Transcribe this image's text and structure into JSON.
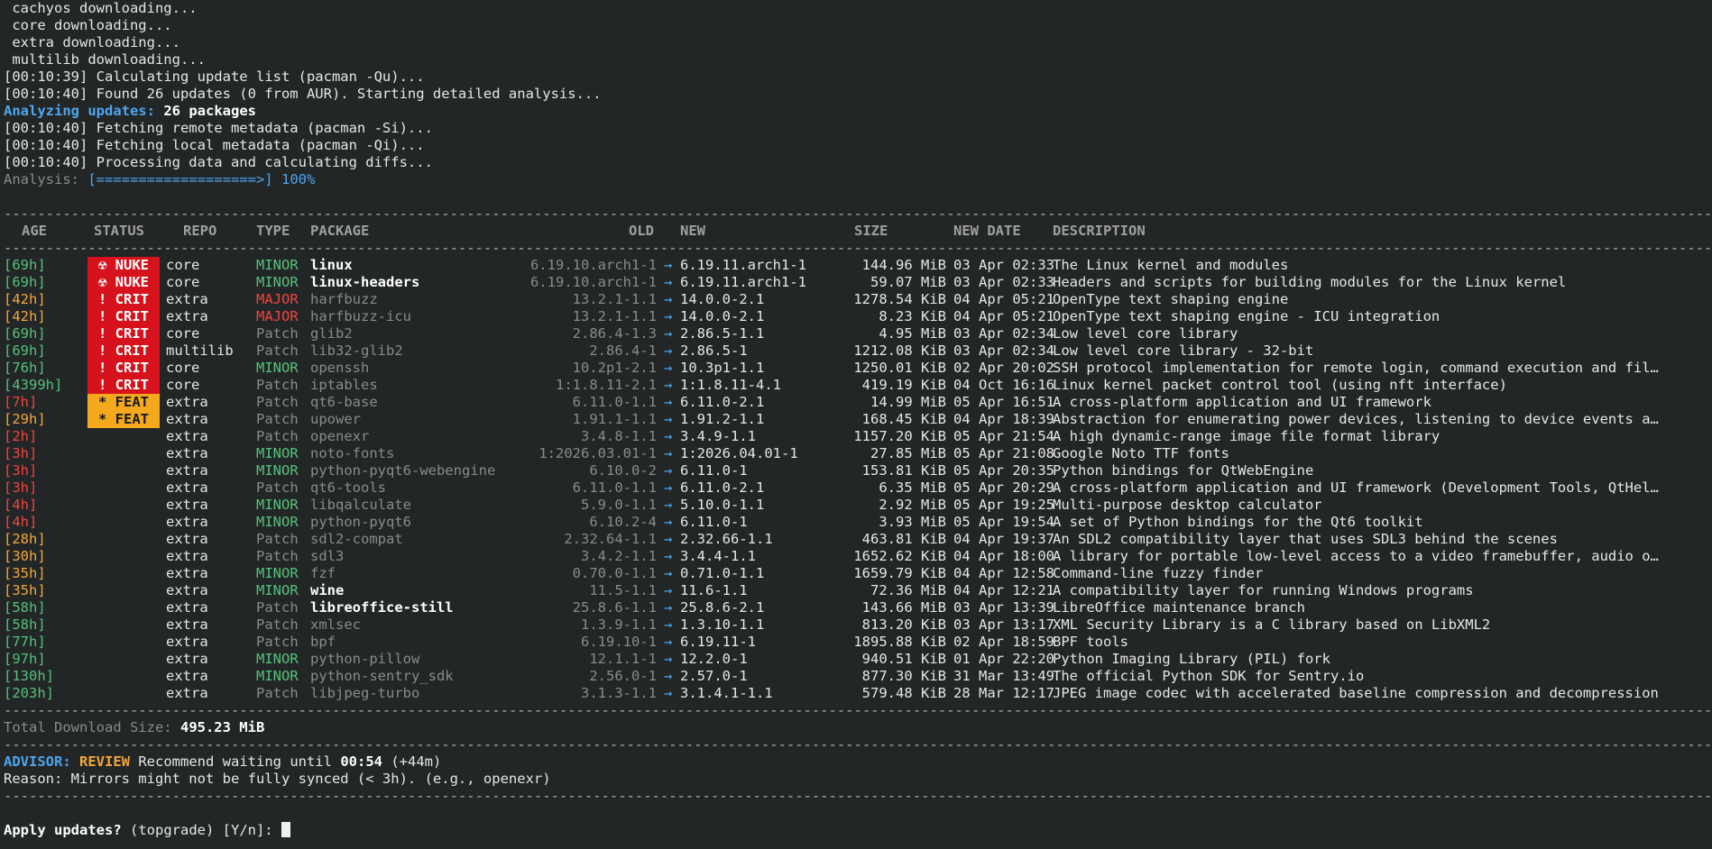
{
  "log": [
    " cachyos downloading...",
    " core downloading...",
    " extra downloading...",
    " multilib downloading...",
    "[00:10:39] Calculating update list (pacman -Qu)...",
    "[00:10:40] Found 26 updates (0 from AUR). Starting detailed analysis..."
  ],
  "analyzing": {
    "label": "Analyzing updates:",
    "count": "26 packages"
  },
  "log2": [
    "[00:10:40] Fetching remote metadata (pacman -Si)...",
    "[00:10:40] Fetching local metadata (pacman -Qi)...",
    "[00:10:40] Processing data and calculating diffs..."
  ],
  "progress": {
    "label": "Analysis:",
    "bar": "[===================>]",
    "percent": "100%"
  },
  "divider": "-----------------------------------------------------------------------------------------------------------------------------------------------------------------------------------------------------------------------------------------------",
  "headers": {
    "age": "AGE",
    "status": "STATUS",
    "repo": "REPO",
    "type": "TYPE",
    "package": "PACKAGE",
    "old": "OLD",
    "new": "NEW",
    "size": "SIZE",
    "date": "NEW DATE",
    "desc": "DESCRIPTION"
  },
  "arrow": "→",
  "colors": {
    "background": "#232627",
    "nuke": "#d6131c",
    "feat": "#f3a81e",
    "accent": "#4ea6ee",
    "minor": "#55c27a",
    "major": "#f0443e"
  },
  "rows": [
    {
      "age": "[69h]",
      "age_color": "grn",
      "status": "☢ NUKE",
      "status_kind": "nuke",
      "repo": "core",
      "type": "MINOR",
      "package": "linux",
      "pkg_bold": true,
      "old": "6.19.10.arch1-1",
      "new": "6.19.11.arch1-1",
      "size": "144.96 MiB",
      "date": "03 Apr 02:33",
      "desc": "The Linux kernel and modules"
    },
    {
      "age": "[69h]",
      "age_color": "grn",
      "status": "☢ NUKE",
      "status_kind": "nuke",
      "repo": "core",
      "type": "MINOR",
      "package": "linux-headers",
      "pkg_bold": true,
      "old": "6.19.10.arch1-1",
      "new": "6.19.11.arch1-1",
      "size": "59.07 MiB",
      "date": "03 Apr 02:33",
      "desc": "Headers and scripts for building modules for the Linux kernel"
    },
    {
      "age": "[42h]",
      "age_color": "yel",
      "status": "! CRIT",
      "status_kind": "crit",
      "repo": "extra",
      "type": "MAJOR",
      "package": "harfbuzz",
      "pkg_bold": false,
      "old": "13.2.1-1.1",
      "new": "14.0.0-2.1",
      "size": "1278.54 KiB",
      "date": "04 Apr 05:21",
      "desc": "OpenType text shaping engine"
    },
    {
      "age": "[42h]",
      "age_color": "yel",
      "status": "! CRIT",
      "status_kind": "crit",
      "repo": "extra",
      "type": "MAJOR",
      "package": "harfbuzz-icu",
      "pkg_bold": false,
      "old": "13.2.1-1.1",
      "new": "14.0.0-2.1",
      "size": "8.23 KiB",
      "date": "04 Apr 05:21",
      "desc": "OpenType text shaping engine - ICU integration"
    },
    {
      "age": "[69h]",
      "age_color": "grn",
      "status": "! CRIT",
      "status_kind": "crit",
      "repo": "core",
      "type": "Patch",
      "package": "glib2",
      "pkg_bold": false,
      "old": "2.86.4-1.3",
      "new": "2.86.5-1.1",
      "size": "4.95 MiB",
      "date": "03 Apr 02:34",
      "desc": "Low level core library"
    },
    {
      "age": "[69h]",
      "age_color": "grn",
      "status": "! CRIT",
      "status_kind": "crit",
      "repo": "multilib",
      "type": "Patch",
      "package": "lib32-glib2",
      "pkg_bold": false,
      "old": "2.86.4-1",
      "new": "2.86.5-1",
      "size": "1212.08 KiB",
      "date": "03 Apr 02:34",
      "desc": "Low level core library - 32-bit"
    },
    {
      "age": "[76h]",
      "age_color": "grn",
      "status": "! CRIT",
      "status_kind": "crit",
      "repo": "core",
      "type": "MINOR",
      "package": "openssh",
      "pkg_bold": false,
      "old": "10.2p1-2.1",
      "new": "10.3p1-1.1",
      "size": "1250.01 KiB",
      "date": "02 Apr 20:02",
      "desc": "SSH protocol implementation for remote login, command execution and fil…"
    },
    {
      "age": "[4399h]",
      "age_color": "grn",
      "status": "! CRIT",
      "status_kind": "crit",
      "repo": "core",
      "type": "Patch",
      "package": "iptables",
      "pkg_bold": false,
      "old": "1:1.8.11-2.1",
      "new": "1:1.8.11-4.1",
      "size": "419.19 KiB",
      "date": "04 Oct 16:16",
      "desc": "Linux kernel packet control tool (using nft interface)"
    },
    {
      "age": "[7h]",
      "age_color": "red",
      "status": "* FEAT",
      "status_kind": "feat",
      "repo": "extra",
      "type": "Patch",
      "package": "qt6-base",
      "pkg_bold": false,
      "old": "6.11.0-1.1",
      "new": "6.11.0-2.1",
      "size": "14.99 MiB",
      "date": "05 Apr 16:51",
      "desc": "A cross-platform application and UI framework"
    },
    {
      "age": "[29h]",
      "age_color": "yel",
      "status": "* FEAT",
      "status_kind": "feat",
      "repo": "extra",
      "type": "Patch",
      "package": "upower",
      "pkg_bold": false,
      "old": "1.91.1-1.1",
      "new": "1.91.2-1.1",
      "size": "168.45 KiB",
      "date": "04 Apr 18:39",
      "desc": "Abstraction for enumerating power devices, listening to device events a…"
    },
    {
      "age": "[2h]",
      "age_color": "red",
      "status": "",
      "status_kind": "none",
      "repo": "extra",
      "type": "Patch",
      "package": "openexr",
      "pkg_bold": false,
      "old": "3.4.8-1.1",
      "new": "3.4.9-1.1",
      "size": "1157.20 KiB",
      "date": "05 Apr 21:54",
      "desc": "A high dynamic-range image file format library"
    },
    {
      "age": "[3h]",
      "age_color": "red",
      "status": "",
      "status_kind": "none",
      "repo": "extra",
      "type": "MINOR",
      "package": "noto-fonts",
      "pkg_bold": false,
      "old": "1:2026.03.01-1",
      "new": "1:2026.04.01-1",
      "size": "27.85 MiB",
      "date": "05 Apr 21:08",
      "desc": "Google Noto TTF fonts"
    },
    {
      "age": "[3h]",
      "age_color": "red",
      "status": "",
      "status_kind": "none",
      "repo": "extra",
      "type": "MINOR",
      "package": "python-pyqt6-webengine",
      "pkg_bold": false,
      "old": "6.10.0-2",
      "new": "6.11.0-1",
      "size": "153.81 KiB",
      "date": "05 Apr 20:35",
      "desc": "Python bindings for QtWebEngine"
    },
    {
      "age": "[3h]",
      "age_color": "red",
      "status": "",
      "status_kind": "none",
      "repo": "extra",
      "type": "Patch",
      "package": "qt6-tools",
      "pkg_bold": false,
      "old": "6.11.0-1.1",
      "new": "6.11.0-2.1",
      "size": "6.35 MiB",
      "date": "05 Apr 20:29",
      "desc": "A cross-platform application and UI framework (Development Tools, QtHel…"
    },
    {
      "age": "[4h]",
      "age_color": "red",
      "status": "",
      "status_kind": "none",
      "repo": "extra",
      "type": "MINOR",
      "package": "libqalculate",
      "pkg_bold": false,
      "old": "5.9.0-1.1",
      "new": "5.10.0-1.1",
      "size": "2.92 MiB",
      "date": "05 Apr 19:25",
      "desc": "Multi-purpose desktop calculator"
    },
    {
      "age": "[4h]",
      "age_color": "red",
      "status": "",
      "status_kind": "none",
      "repo": "extra",
      "type": "MINOR",
      "package": "python-pyqt6",
      "pkg_bold": false,
      "old": "6.10.2-4",
      "new": "6.11.0-1",
      "size": "3.93 MiB",
      "date": "05 Apr 19:54",
      "desc": "A set of Python bindings for the Qt6 toolkit"
    },
    {
      "age": "[28h]",
      "age_color": "yel",
      "status": "",
      "status_kind": "none",
      "repo": "extra",
      "type": "Patch",
      "package": "sdl2-compat",
      "pkg_bold": false,
      "old": "2.32.64-1.1",
      "new": "2.32.66-1.1",
      "size": "463.81 KiB",
      "date": "04 Apr 19:37",
      "desc": "An SDL2 compatibility layer that uses SDL3 behind the scenes"
    },
    {
      "age": "[30h]",
      "age_color": "yel",
      "status": "",
      "status_kind": "none",
      "repo": "extra",
      "type": "Patch",
      "package": "sdl3",
      "pkg_bold": false,
      "old": "3.4.2-1.1",
      "new": "3.4.4-1.1",
      "size": "1652.62 KiB",
      "date": "04 Apr 18:00",
      "desc": "A library for portable low-level access to a video framebuffer, audio o…"
    },
    {
      "age": "[35h]",
      "age_color": "yel",
      "status": "",
      "status_kind": "none",
      "repo": "extra",
      "type": "MINOR",
      "package": "fzf",
      "pkg_bold": false,
      "old": "0.70.0-1.1",
      "new": "0.71.0-1.1",
      "size": "1659.79 KiB",
      "date": "04 Apr 12:58",
      "desc": "Command-line fuzzy finder"
    },
    {
      "age": "[35h]",
      "age_color": "yel",
      "status": "",
      "status_kind": "none",
      "repo": "extra",
      "type": "MINOR",
      "package": "wine",
      "pkg_bold": true,
      "old": "11.5-1.1",
      "new": "11.6-1.1",
      "size": "72.36 MiB",
      "date": "04 Apr 12:21",
      "desc": "A compatibility layer for running Windows programs"
    },
    {
      "age": "[58h]",
      "age_color": "grn",
      "status": "",
      "status_kind": "none",
      "repo": "extra",
      "type": "Patch",
      "package": "libreoffice-still",
      "pkg_bold": true,
      "old": "25.8.6-1.1",
      "new": "25.8.6-2.1",
      "size": "143.66 MiB",
      "date": "03 Apr 13:39",
      "desc": "LibreOffice maintenance branch"
    },
    {
      "age": "[58h]",
      "age_color": "grn",
      "status": "",
      "status_kind": "none",
      "repo": "extra",
      "type": "Patch",
      "package": "xmlsec",
      "pkg_bold": false,
      "old": "1.3.9-1.1",
      "new": "1.3.10-1.1",
      "size": "813.20 KiB",
      "date": "03 Apr 13:17",
      "desc": "XML Security Library is a C library based on LibXML2"
    },
    {
      "age": "[77h]",
      "age_color": "grn",
      "status": "",
      "status_kind": "none",
      "repo": "extra",
      "type": "Patch",
      "package": "bpf",
      "pkg_bold": false,
      "old": "6.19.10-1",
      "new": "6.19.11-1",
      "size": "1895.88 KiB",
      "date": "02 Apr 18:59",
      "desc": "BPF tools"
    },
    {
      "age": "[97h]",
      "age_color": "grn",
      "status": "",
      "status_kind": "none",
      "repo": "extra",
      "type": "MINOR",
      "package": "python-pillow",
      "pkg_bold": false,
      "old": "12.1.1-1",
      "new": "12.2.0-1",
      "size": "940.51 KiB",
      "date": "01 Apr 22:20",
      "desc": "Python Imaging Library (PIL) fork"
    },
    {
      "age": "[130h]",
      "age_color": "grn",
      "status": "",
      "status_kind": "none",
      "repo": "extra",
      "type": "MINOR",
      "package": "python-sentry_sdk",
      "pkg_bold": false,
      "old": "2.56.0-1",
      "new": "2.57.0-1",
      "size": "877.30 KiB",
      "date": "31 Mar 13:49",
      "desc": "The official Python SDK for Sentry.io"
    },
    {
      "age": "[203h]",
      "age_color": "grn",
      "status": "",
      "status_kind": "none",
      "repo": "extra",
      "type": "Patch",
      "package": "libjpeg-turbo",
      "pkg_bold": false,
      "old": "3.1.3-1.1",
      "new": "3.1.4.1-1.1",
      "size": "579.48 KiB",
      "date": "28 Mar 12:17",
      "desc": "JPEG image codec with accelerated baseline compression and decompression"
    }
  ],
  "total": {
    "label": "Total Download Size:",
    "value": "495.23 MiB"
  },
  "advisor": {
    "label": "ADVISOR:",
    "verdict": "REVIEW",
    "text": "Recommend waiting until",
    "until": "00:54",
    "delta": "(+44m)"
  },
  "reason": "Reason: Mirrors might not be fully synced (< 3h). (e.g., openexr)",
  "prompt": {
    "text": "Apply updates?",
    "hint": "(topgrade) [Y/n]:"
  }
}
